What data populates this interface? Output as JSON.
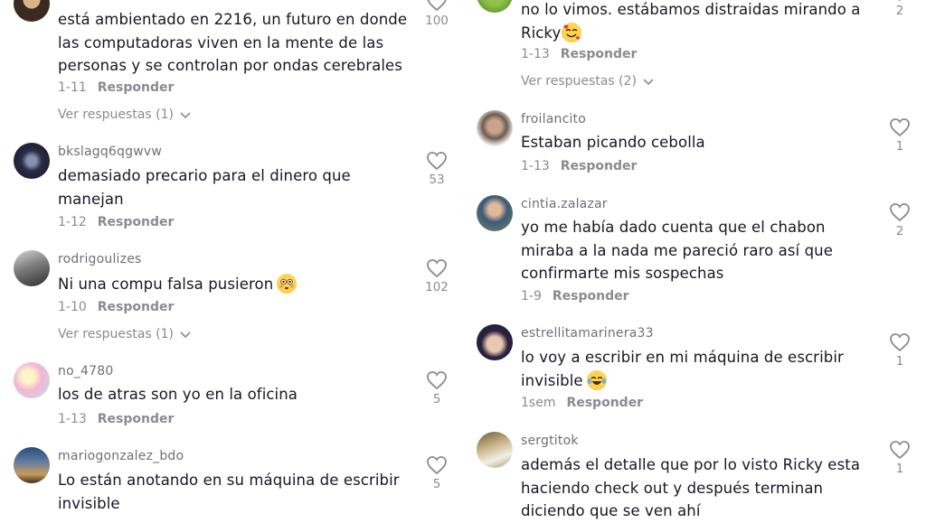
{
  "reply_label": "Responder",
  "left": {
    "c1": {
      "username": "",
      "text": "está ambientado en 2216, un futuro en donde las computadoras viven en la mente de las personas y se controlan por ondas cerebrales",
      "date": "1-11",
      "replies": "Ver respuestas (1)",
      "likes": "100"
    },
    "c2": {
      "username": "bkslagq6qgwvw",
      "text": "demasiado precario para el dinero que manejan",
      "date": "1-12",
      "likes": "53"
    },
    "c3": {
      "username": "rodrigoulizes",
      "text": "Ni una compu falsa pusieron",
      "emoji": "flushed-face-emoji",
      "date": "1-10",
      "replies": "Ver respuestas (1)",
      "likes": "102"
    },
    "c4": {
      "username": "no_4780",
      "text": "los de atras son yo en la oficina",
      "date": "1-13",
      "likes": "5"
    },
    "c5": {
      "username": "mariogonzalez_bdo",
      "text": "Lo están anotando en su máquina de escribir invisible",
      "likes": "5"
    }
  },
  "right": {
    "c1": {
      "text_line1": "no lo vimos. estábamos distraidas mirando a",
      "text_line2": "Ricky",
      "emoji": "smiling-face-with-hearts-emoji",
      "date": "1-13",
      "replies": "Ver respuestas (2)",
      "likes": "2"
    },
    "c2": {
      "username": "froilancito",
      "text": "Estaban picando cebolla",
      "date": "1-13",
      "likes": "1"
    },
    "c3": {
      "username": "cintia.zalazar",
      "text": "yo me había dado cuenta que el chabon miraba a la nada me pareció raro así que confirmarte mis sospechas",
      "date": "1-9",
      "likes": "2"
    },
    "c4": {
      "username": "estrellitamarinera33",
      "text": "lo voy a escribir en mi máquina de escribir invisible",
      "emoji": "tears-of-joy-emoji",
      "date": "1sem",
      "likes": "1"
    },
    "c5": {
      "username": "sergtitok",
      "text": "además el detalle que por lo visto Ricky esta haciendo check out y después terminan diciendo que se ven ahí",
      "likes": "1"
    }
  }
}
